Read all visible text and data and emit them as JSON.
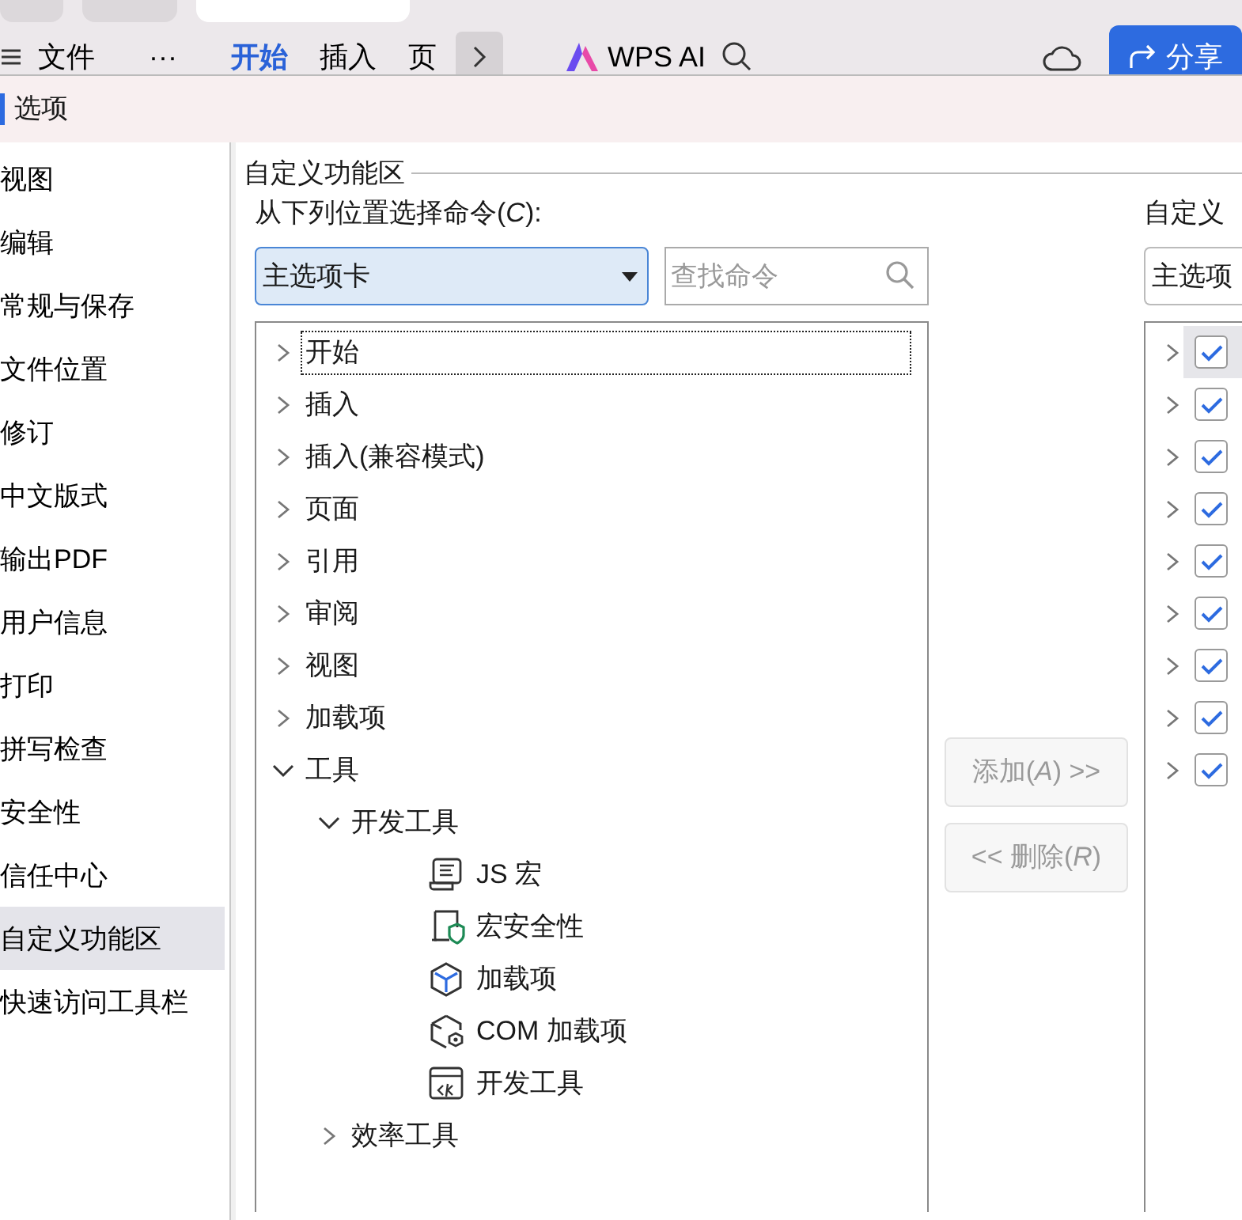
{
  "browser_tabs": [
    {
      "selected": false
    },
    {
      "selected": false
    },
    {
      "selected": true
    }
  ],
  "app_toolbar": {
    "menu": "文件",
    "more": "···",
    "tabs": [
      {
        "label": "开始",
        "selected": true
      },
      {
        "label": "插入",
        "selected": false
      },
      {
        "label": "页",
        "selected": false
      }
    ],
    "ai": "WPS AI",
    "share": "分享"
  },
  "dialog": {
    "title": "选项"
  },
  "sidebar": {
    "items": [
      {
        "label": "视图",
        "selected": false
      },
      {
        "label": "编辑",
        "selected": false
      },
      {
        "label": "常规与保存",
        "selected": false
      },
      {
        "label": "文件位置",
        "selected": false
      },
      {
        "label": "修订",
        "selected": false
      },
      {
        "label": "中文版式",
        "selected": false
      },
      {
        "label": "输出PDF",
        "selected": false
      },
      {
        "label": "用户信息",
        "selected": false
      },
      {
        "label": "打印",
        "selected": false
      },
      {
        "label": "拼写检查",
        "selected": false
      },
      {
        "label": "安全性",
        "selected": false
      },
      {
        "label": "信任中心",
        "selected": false
      },
      {
        "label": "自定义功能区",
        "selected": true
      },
      {
        "label": "快速访问工具栏",
        "selected": false
      }
    ]
  },
  "group": {
    "title": "自定义功能区"
  },
  "commands": {
    "label": "从下列位置选择命令(*C*):",
    "source": "主选项卡",
    "search_placeholder": "查找命令",
    "tree": [
      {
        "label": "开始",
        "expanded": false,
        "focused": true
      },
      {
        "label": "插入",
        "expanded": false,
        "focused": false
      },
      {
        "label": "插入(兼容模式)",
        "expanded": false,
        "focused": false
      },
      {
        "label": "页面",
        "expanded": false,
        "focused": false
      },
      {
        "label": "引用",
        "expanded": false,
        "focused": false
      },
      {
        "label": "审阅",
        "expanded": false,
        "focused": false
      },
      {
        "label": "视图",
        "expanded": false,
        "focused": false
      },
      {
        "label": "加载项",
        "expanded": false,
        "focused": false
      },
      {
        "label": "工具",
        "expanded": true,
        "focused": false,
        "children": [
          {
            "label": "开发工具",
            "expanded": true,
            "focused": false,
            "children": [
              {
                "label": "JS 宏",
                "kind": "js"
              },
              {
                "label": "宏安全性",
                "kind": "shield"
              },
              {
                "label": "加载项",
                "kind": "cube"
              },
              {
                "label": "COM 加载项",
                "kind": "com"
              },
              {
                "label": "开发工具",
                "kind": "dev"
              }
            ]
          },
          {
            "label": "效率工具",
            "expanded": false,
            "focused": false
          }
        ]
      }
    ]
  },
  "buttons": [
    {
      "label": "添加(*A*) >>",
      "disabled": true
    },
    {
      "label": "<< 删除(*R*)",
      "disabled": true
    }
  ],
  "ribbon": {
    "label": "自定义",
    "target": "主选项",
    "rows": [
      {
        "checked": true,
        "selected": true
      },
      {
        "checked": true,
        "selected": false
      },
      {
        "checked": true,
        "selected": false
      },
      {
        "checked": true,
        "selected": false
      },
      {
        "checked": true,
        "selected": false
      },
      {
        "checked": true,
        "selected": false
      },
      {
        "checked": true,
        "selected": false
      },
      {
        "checked": true,
        "selected": false
      },
      {
        "checked": true,
        "selected": false
      }
    ]
  }
}
